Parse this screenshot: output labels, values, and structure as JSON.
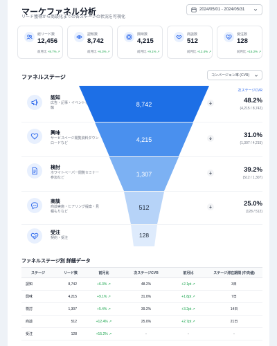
{
  "header": {
    "title": "マーケファネル分析",
    "subtitle": "リード獲得から商談化までの各ステージの状況を可視化",
    "date_range": "2024/05/01 - 2024/05/31"
  },
  "kpis": [
    {
      "label": "総リード数",
      "value": "12,456",
      "prefix": "前月比",
      "delta": "+8.7%",
      "icon": "users-icon",
      "color": "#2563eb",
      "bg": "#e8f0fe"
    },
    {
      "label": "認知数",
      "value": "8,742",
      "prefix": "前月比",
      "delta": "+6.3%",
      "icon": "eye-icon",
      "color": "#2563eb",
      "bg": "#e8f0fe"
    },
    {
      "label": "興味数",
      "value": "4,215",
      "prefix": "前月比",
      "delta": "+9.1%",
      "icon": "target-icon",
      "color": "#2563eb",
      "bg": "#e8f0fe"
    },
    {
      "label": "商談数",
      "value": "512",
      "prefix": "前月比",
      "delta": "+12.4%",
      "icon": "handshake-icon",
      "color": "#2563eb",
      "bg": "#e8f0fe"
    },
    {
      "label": "受注数",
      "value": "128",
      "prefix": "前月比",
      "delta": "+15.2%",
      "icon": "award-icon",
      "color": "#2563eb",
      "bg": "#e8f0fe"
    }
  ],
  "funnel": {
    "title": "ファネルステージ",
    "metric_select": "コンバージョン率 (CVR)",
    "next_header": "次ステージCVR",
    "stages": [
      {
        "name": "認知",
        "desc": "広告・記事・イベントなどの接触",
        "value": "8,742",
        "rate": "48.2%",
        "ratio": "(4,215 / 8,742)",
        "icon": "megaphone-icon",
        "color": "#1d6fe6"
      },
      {
        "name": "興味",
        "desc": "サービスページ閲覧資料ダウンロードなど",
        "value": "4,215",
        "rate": "31.0%",
        "ratio": "(1,307 / 4,215)",
        "icon": "heart-icon",
        "color": "#4a90ee"
      },
      {
        "name": "検討",
        "desc": "ホワイトペーパー閲覧セミナー参加など",
        "value": "1,307",
        "rate": "39.2%",
        "ratio": "(512 / 1,307)",
        "icon": "document-icon",
        "color": "#7cb1f3"
      },
      {
        "name": "商談",
        "desc": "商談実施・ヒアリング提案・見積もりなど",
        "value": "512",
        "rate": "25.0%",
        "ratio": "(128 / 512)",
        "icon": "chat-icon",
        "color": "#b6d3f8"
      },
      {
        "name": "受注",
        "desc": "契約・受注",
        "value": "128",
        "rate": "",
        "ratio": "",
        "icon": "handshake-heart-icon",
        "color": "#deebfc"
      }
    ]
  },
  "table": {
    "title": "ファネルステージ別 詳細データ",
    "headers": [
      "ステージ",
      "リード数",
      "前月比",
      "次ステージCVR",
      "前月比",
      "ステージ滞在期間 (中央値)"
    ],
    "rows": [
      [
        "認知",
        "8,742",
        "+6.3%",
        "48.2%",
        "+2.1pt",
        "3日"
      ],
      [
        "興味",
        "4,215",
        "+9.1%",
        "31.0%",
        "+1.8pt",
        "7日"
      ],
      [
        "検討",
        "1,307",
        "+5.4%",
        "39.2%",
        "+3.2pt",
        "14日"
      ],
      [
        "商談",
        "512",
        "+12.4%",
        "25.0%",
        "+2.7pt",
        "21日"
      ],
      [
        "受注",
        "128",
        "+15.2%",
        "-",
        "-",
        "-"
      ]
    ]
  }
}
